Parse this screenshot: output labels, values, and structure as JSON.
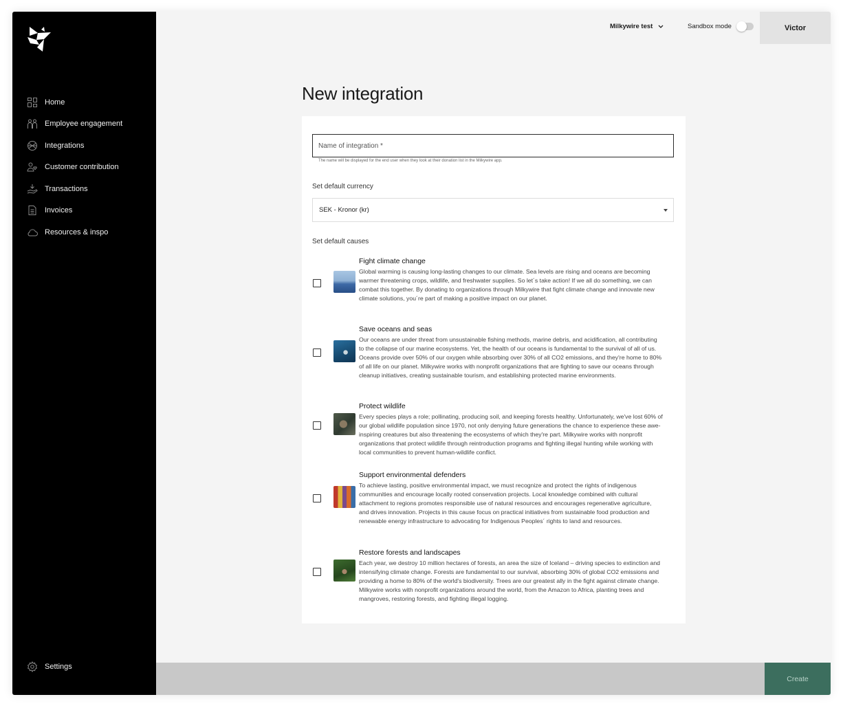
{
  "sidebar": {
    "items": [
      {
        "label": "Home",
        "icon": "home-grid-icon"
      },
      {
        "label": "Employee engagement",
        "icon": "people-icon"
      },
      {
        "label": "Integrations",
        "icon": "integrations-icon"
      },
      {
        "label": "Customer contribution",
        "icon": "user-heart-icon"
      },
      {
        "label": "Transactions",
        "icon": "hand-coin-icon"
      },
      {
        "label": "Invoices",
        "icon": "document-icon"
      },
      {
        "label": "Resources & inspo",
        "icon": "cloud-icon"
      }
    ],
    "settings": {
      "label": "Settings",
      "icon": "gear-icon"
    }
  },
  "topbar": {
    "org": "Milkywire test",
    "sandbox_label": "Sandbox mode",
    "sandbox_on": false,
    "user": "Victor"
  },
  "page": {
    "title": "New integration"
  },
  "form": {
    "name_placeholder": "Name of integration *",
    "name_hint": "The name will be displayed for the end user when they look at their donation list in the Milkywire app.",
    "currency_label": "Set default currency",
    "currency_value": "SEK - Kronor (kr)",
    "causes_label": "Set default causes",
    "causes": [
      {
        "title": "Fight climate change",
        "description": "Global warming is causing long-lasting changes to our climate. Sea levels are rising and oceans are becoming warmer threatening crops, wildlife, and freshwater supplies. So let´s take action! If we all do something, we can combat this together. By donating to organizations through Milkywire that fight climate change and innovate new climate solutions, you´re part of making a positive impact on our planet.",
        "checked": false
      },
      {
        "title": "Save oceans and seas",
        "description": "Our oceans are under threat from unsustainable fishing methods, marine debris, and acidification, all contributing to the collapse of our marine ecosystems. Yet, the health of our oceans is fundamental to the survival of all of us. Oceans provide over 50% of our oxygen while absorbing over 30% of all CO2 emissions, and they're home to 80% of all life on our planet. Milkywire works with nonprofit organizations that are fighting to save our oceans through cleanup initiatives, creating sustainable tourism, and establishing protected marine environments.",
        "checked": false
      },
      {
        "title": "Protect wildlife",
        "description": "Every species plays a role; pollinating, producing soil, and keeping forests healthy. Unfortunately, we've lost 60% of our global wildlife population since 1970, not only denying future generations the chance to experience these awe-inspiring creatures but also threatening the ecosystems of which they're part. Milkywire works with nonprofit organizations that protect wildlife through reintroduction programs and fighting illegal hunting while working with local communities to prevent human-wildlife conflict.",
        "checked": false
      },
      {
        "title": "Support environmental defenders",
        "description": "To achieve lasting, positive environmental impact, we must recognize and protect the rights of indigenous communities and encourage locally rooted conservation projects. Local knowledge combined with cultural attachment to regions promotes responsible use of natural resources and encourages regenerative agriculture, and drives innovation. Projects in this cause focus on practical initiatives from sustainable food production and renewable energy infrastructure to advocating for Indigenous Peoples´ rights to land and resources.",
        "checked": false
      },
      {
        "title": "Restore forests and landscapes",
        "description": "Each year, we destroy 10 million hectares of forests, an area the size of Iceland – driving species to extinction and intensifying climate change. Forests are fundamental to our survival, absorbing 30% of global CO2 emissions and providing a home to 80% of the world's biodiversity. Trees are our greatest ally in the fight against climate change. Milkywire works with nonprofit organizations around the world, from the Amazon to Africa, planting trees and mangroves, restoring forests, and fighting illegal logging.",
        "checked": false
      }
    ]
  },
  "footer": {
    "create_label": "Create"
  },
  "colors": {
    "sidebar_bg": "#000000",
    "page_bg": "#f4f4f4",
    "create_button": "#3c6e5e",
    "footer_bar": "#c8c8c8"
  }
}
